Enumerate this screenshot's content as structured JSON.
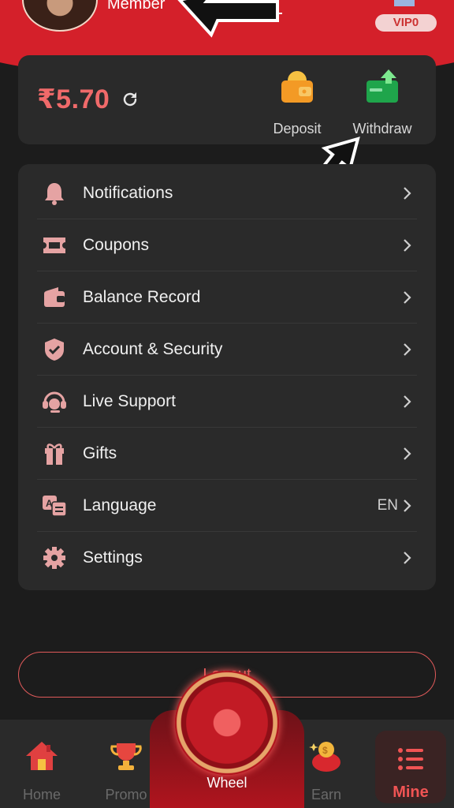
{
  "header": {
    "member_label": "Member",
    "vip_label": "VIP0"
  },
  "wallet": {
    "balance": "₹5.70",
    "deposit_label": "Deposit",
    "withdraw_label": "Withdraw"
  },
  "menu": {
    "items": [
      {
        "label": "Notifications",
        "icon": "bell-icon",
        "value": ""
      },
      {
        "label": "Coupons",
        "icon": "ticket-icon",
        "value": ""
      },
      {
        "label": "Balance Record",
        "icon": "wallet-icon",
        "value": ""
      },
      {
        "label": "Account & Security",
        "icon": "shield-icon",
        "value": ""
      },
      {
        "label": "Live Support",
        "icon": "headset-icon",
        "value": ""
      },
      {
        "label": "Gifts",
        "icon": "gift-icon",
        "value": ""
      },
      {
        "label": "Language",
        "icon": "translate-icon",
        "value": "EN"
      },
      {
        "label": "Settings",
        "icon": "gear-icon",
        "value": ""
      }
    ]
  },
  "logout_label": "Logout",
  "nav": {
    "home": "Home",
    "promo": "Promo",
    "wheel": "Wheel",
    "earn": "Earn",
    "mine": "Mine"
  },
  "colors": {
    "accent": "#d4202a",
    "balance": "#f06a6a",
    "icon_tint": "#e5a3a3",
    "card_bg": "#2a2a2a",
    "page_bg": "#1c1c1c"
  }
}
